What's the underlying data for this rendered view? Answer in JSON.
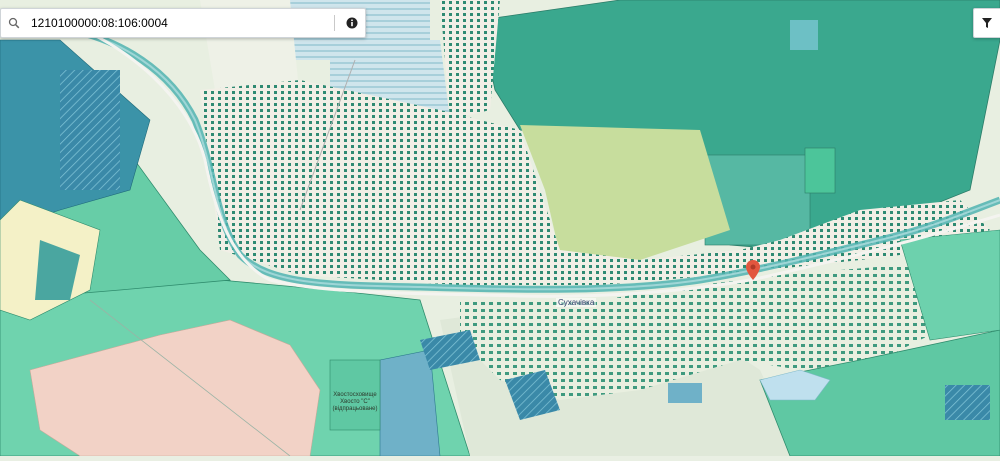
{
  "search": {
    "value": "1210100000:08:106:0004",
    "icon": "search-icon"
  },
  "toolbar": {
    "info_icon": "info-circle-icon",
    "filter_icon": "filter-icon"
  },
  "map": {
    "labels": {
      "village": "Сухачівка",
      "field": "Хвостосховище Хвосто \"С\" (відпрацьоване)"
    },
    "marker_icon": "map-pin-icon",
    "colors": {
      "forest": "#3aa88e",
      "parcel": "#2e8a72",
      "field": "#6fd3ae",
      "road": "#eef0ee",
      "river": "#4fb3b0",
      "sand": "#f2d2c6",
      "marker": "#e2563f"
    }
  }
}
